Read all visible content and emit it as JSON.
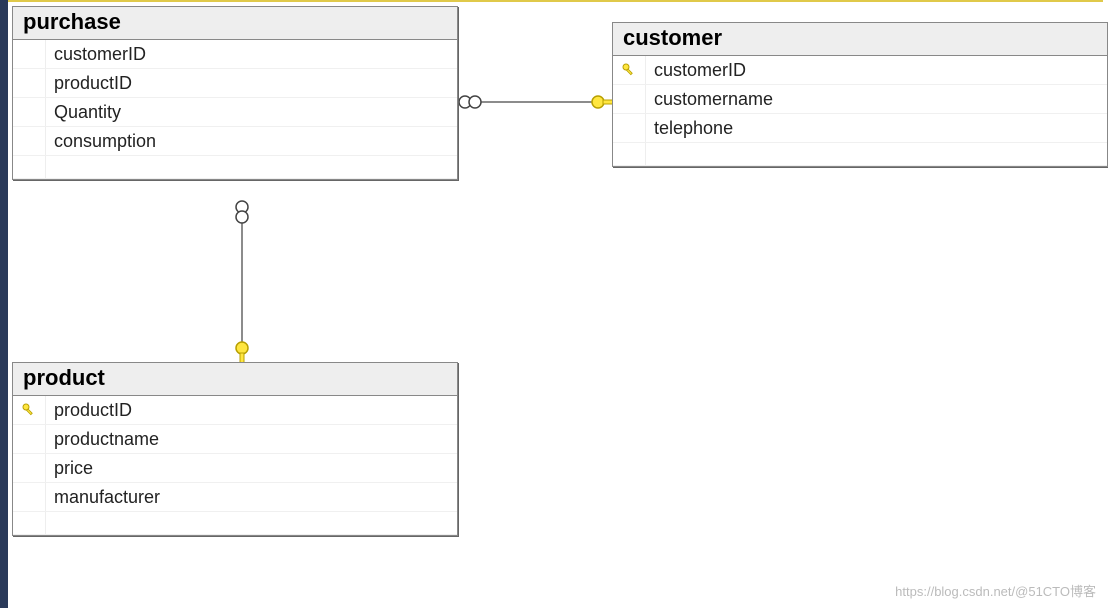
{
  "tables": {
    "purchase": {
      "title": "purchase",
      "columns": [
        {
          "name": "customerID",
          "pk": false
        },
        {
          "name": "productID",
          "pk": false
        },
        {
          "name": "Quantity",
          "pk": false
        },
        {
          "name": "consumption",
          "pk": false
        }
      ]
    },
    "customer": {
      "title": "customer",
      "columns": [
        {
          "name": "customerID",
          "pk": true
        },
        {
          "name": "customername",
          "pk": false
        },
        {
          "name": "telephone",
          "pk": false
        }
      ]
    },
    "product": {
      "title": "product",
      "columns": [
        {
          "name": "productID",
          "pk": true
        },
        {
          "name": "productname",
          "pk": false
        },
        {
          "name": "price",
          "pk": false
        },
        {
          "name": "manufacturer",
          "pk": false
        }
      ]
    }
  },
  "relationships": [
    {
      "from": "purchase.customerID",
      "to": "customer.customerID",
      "many_side": "purchase",
      "one_side": "customer"
    },
    {
      "from": "purchase.productID",
      "to": "product.productID",
      "many_side": "purchase",
      "one_side": "product"
    }
  ],
  "watermark": "https://blog.csdn.net/@51CTO博客"
}
